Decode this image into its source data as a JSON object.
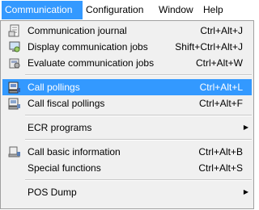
{
  "menubar": {
    "items": [
      {
        "label": "Communication"
      },
      {
        "label": "Configuration"
      },
      {
        "label": "Window"
      },
      {
        "label": "Help"
      }
    ]
  },
  "menu": {
    "items": [
      {
        "label": "Communication journal",
        "shortcut": "Ctrl+Alt+J",
        "icon": "journal-icon"
      },
      {
        "label": "Display communication jobs",
        "shortcut": "Shift+Ctrl+Alt+J",
        "icon": "display-jobs-icon"
      },
      {
        "label": "Evaluate communication jobs",
        "shortcut": "Ctrl+Alt+W",
        "icon": "evaluate-jobs-icon"
      },
      {
        "label": "Call pollings",
        "shortcut": "Ctrl+Alt+L",
        "icon": "call-pollings-icon",
        "highlighted": true
      },
      {
        "label": "Call fiscal pollings",
        "shortcut": "Ctrl+Alt+F",
        "icon": "fiscal-pollings-icon"
      },
      {
        "label": "ECR programs",
        "submenu": true
      },
      {
        "label": "Call basic information",
        "shortcut": "Ctrl+Alt+B",
        "icon": "basic-info-icon"
      },
      {
        "label": "Special functions",
        "shortcut": "Ctrl+Alt+S"
      },
      {
        "label": "POS Dump",
        "submenu": true
      }
    ]
  },
  "colors": {
    "highlight": "#3399ff",
    "menu_bg": "#f0f0f0"
  }
}
